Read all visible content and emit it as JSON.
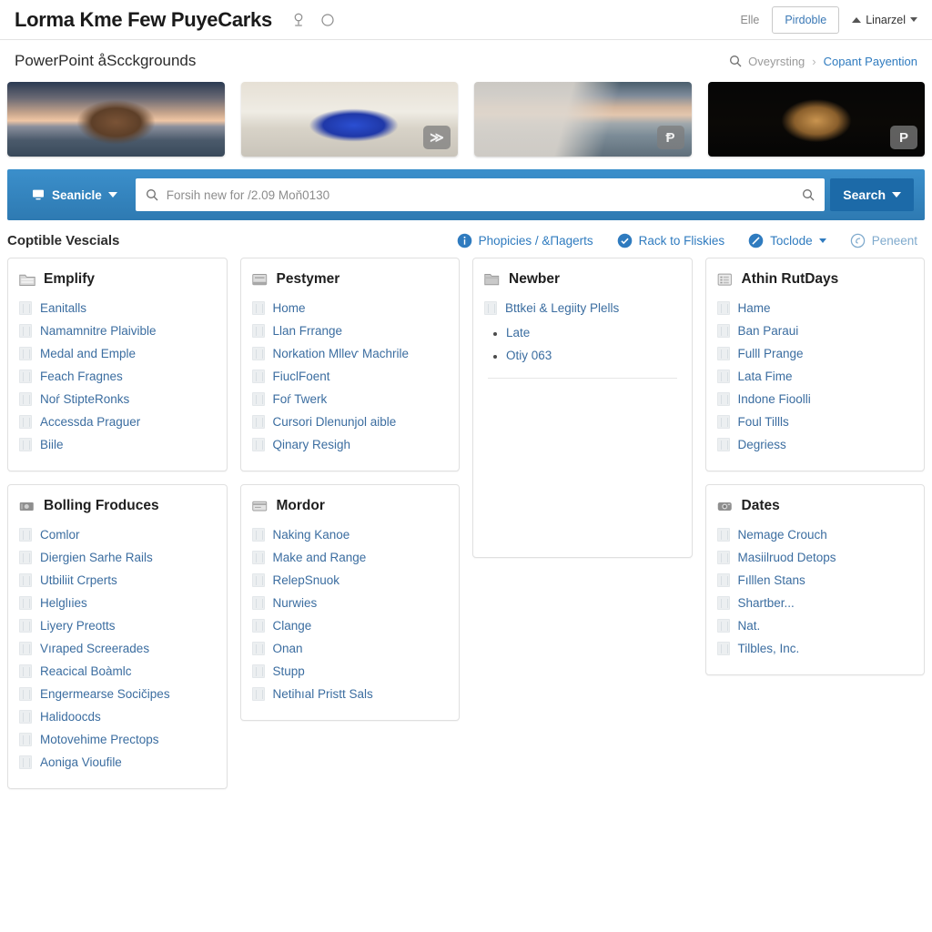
{
  "header": {
    "brand": "Lorma Kme Few PuyeCarks",
    "icons": [
      "location-pin-icon",
      "circle-outline-icon"
    ],
    "link_label": "Elle",
    "button_label": "Pirdoble",
    "user_label": "Linarzel"
  },
  "page": {
    "title": "PowerPoint åScckgrounds",
    "breadcrumb": {
      "root": "Oveyrsting",
      "separator": "›",
      "current": "Copant Payention"
    }
  },
  "thumbnails": [
    {
      "name": "tower-bridge-thumbnail",
      "badge": ""
    },
    {
      "name": "blue-sports-car-thumbnail",
      "badge": "≫"
    },
    {
      "name": "railway-bridge-thumbnail",
      "badge": "Ᵽ"
    },
    {
      "name": "golden-dog-thumbnail",
      "badge": "P"
    }
  ],
  "search": {
    "scope_label": "Seanicle",
    "placeholder": "Forsih new for /2.09 Moň0130",
    "value": "",
    "button_label": "Search"
  },
  "toolbar": {
    "section_title": "Coptible Vescials",
    "actions": [
      {
        "label": "Phopicies / &Πagertѕ",
        "icon": "info-circle-icon",
        "caret": false,
        "dim": false
      },
      {
        "label": "Rack to Fliskies",
        "icon": "check-circle-icon",
        "caret": false,
        "dim": false
      },
      {
        "label": "Toclode",
        "icon": "slash-circle-icon",
        "caret": true,
        "dim": false
      },
      {
        "label": "Peneent",
        "icon": "spiral-circle-icon",
        "caret": false,
        "dim": true
      }
    ]
  },
  "cards": [
    {
      "title": "Emplify",
      "icon": "folder-open-icon",
      "items": [
        "Eanitalls",
        "Namamnitre Plaivible",
        "Medal and Emple",
        "Feach Fragnes",
        "Noŕ StipteRonks",
        "Accessda Praguer",
        "Biile"
      ],
      "bullets": [],
      "divider": false
    },
    {
      "title": "Pestymer",
      "icon": "window-icon",
      "items": [
        "Home",
        "Llan Frrange",
        "Norkation Mlleѵ Machrile",
        "FiuclFoent",
        "Foŕ Twerk",
        "Cursori Dlenunjol aible",
        "Qinary Resigh"
      ],
      "bullets": [],
      "divider": false
    },
    {
      "title": "Newber",
      "icon": "folder-icon",
      "items": [
        "Bttkei & Legiity Plells"
      ],
      "bullets": [
        "Late",
        "Otiy 063"
      ],
      "divider": true
    },
    {
      "title": "Athin RutDays",
      "icon": "list-box-icon",
      "items": [
        "Hame",
        "Ban Paraui",
        "Fulll Prange",
        "Lata Fime",
        "Indone Fioolli",
        "Foul Tillls",
        "Degriess"
      ],
      "bullets": [],
      "divider": false
    },
    {
      "title": "Bolling Froduces",
      "icon": "money-icon",
      "items": [
        "Comlor",
        "Diergien Sarhe Rails",
        "Utbiliit Crperts",
        "Helglıies",
        "Liyery Preotts",
        "Vıraped Screerades",
        "Reacical Boàmlc",
        "Engermearse Socičipes",
        "Halidoocds",
        "Motovehime Prectops",
        "Aoniga Vioufile"
      ],
      "bullets": [],
      "divider": false
    },
    {
      "title": "Mordor",
      "icon": "card-icon",
      "items": [
        "Naking Kanoe",
        "Make and Range",
        "RelepSnuok",
        "Nurwies",
        "Clange",
        "Onan",
        "Stupp",
        "Netihıal Pristt Sals"
      ],
      "bullets": [],
      "divider": false
    },
    {
      "title": "Dates",
      "icon": "camera-icon",
      "items": [
        "Nemage Crouch",
        "Masiilruod Detops",
        "Fılllen Stans",
        "Shartber...",
        "Nat.",
        "Tilbles, Inc."
      ],
      "bullets": [],
      "divider": false
    }
  ],
  "colors": {
    "accent_blue": "#2f7bbf",
    "band_blue": "#3b8fcb",
    "button_blue": "#1c6aa8",
    "link_blue": "#3b6da0"
  }
}
